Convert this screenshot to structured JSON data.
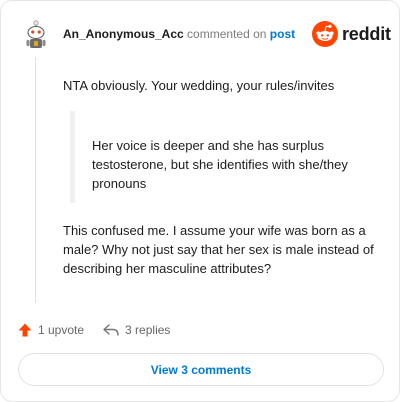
{
  "comment": {
    "username": "An_Anonymous_Acc",
    "commented_on": "commented on",
    "post_link": "post",
    "paragraph1": "NTA obviously. Your wedding, your rules/invites",
    "quote": "Her voice is deeper and she has surplus testosterone, but she identifies with she/they pronouns",
    "paragraph2": "This confused me. I assume your wife was born as a male? Why not just say that her sex is male instead of describing her masculine attributes?"
  },
  "brand": {
    "word": "reddit",
    "icon": "reddit-alien-icon",
    "color": "#ff4500"
  },
  "actions": {
    "upvote_label": "1 upvote",
    "upvote_icon": "upvote-arrow-icon",
    "replies_label": "3 replies",
    "replies_icon": "reply-arrow-icon"
  },
  "view_comments": {
    "label": "View 3 comments"
  },
  "colors": {
    "accent": "#0079d3",
    "upvote": "#ff4500"
  }
}
